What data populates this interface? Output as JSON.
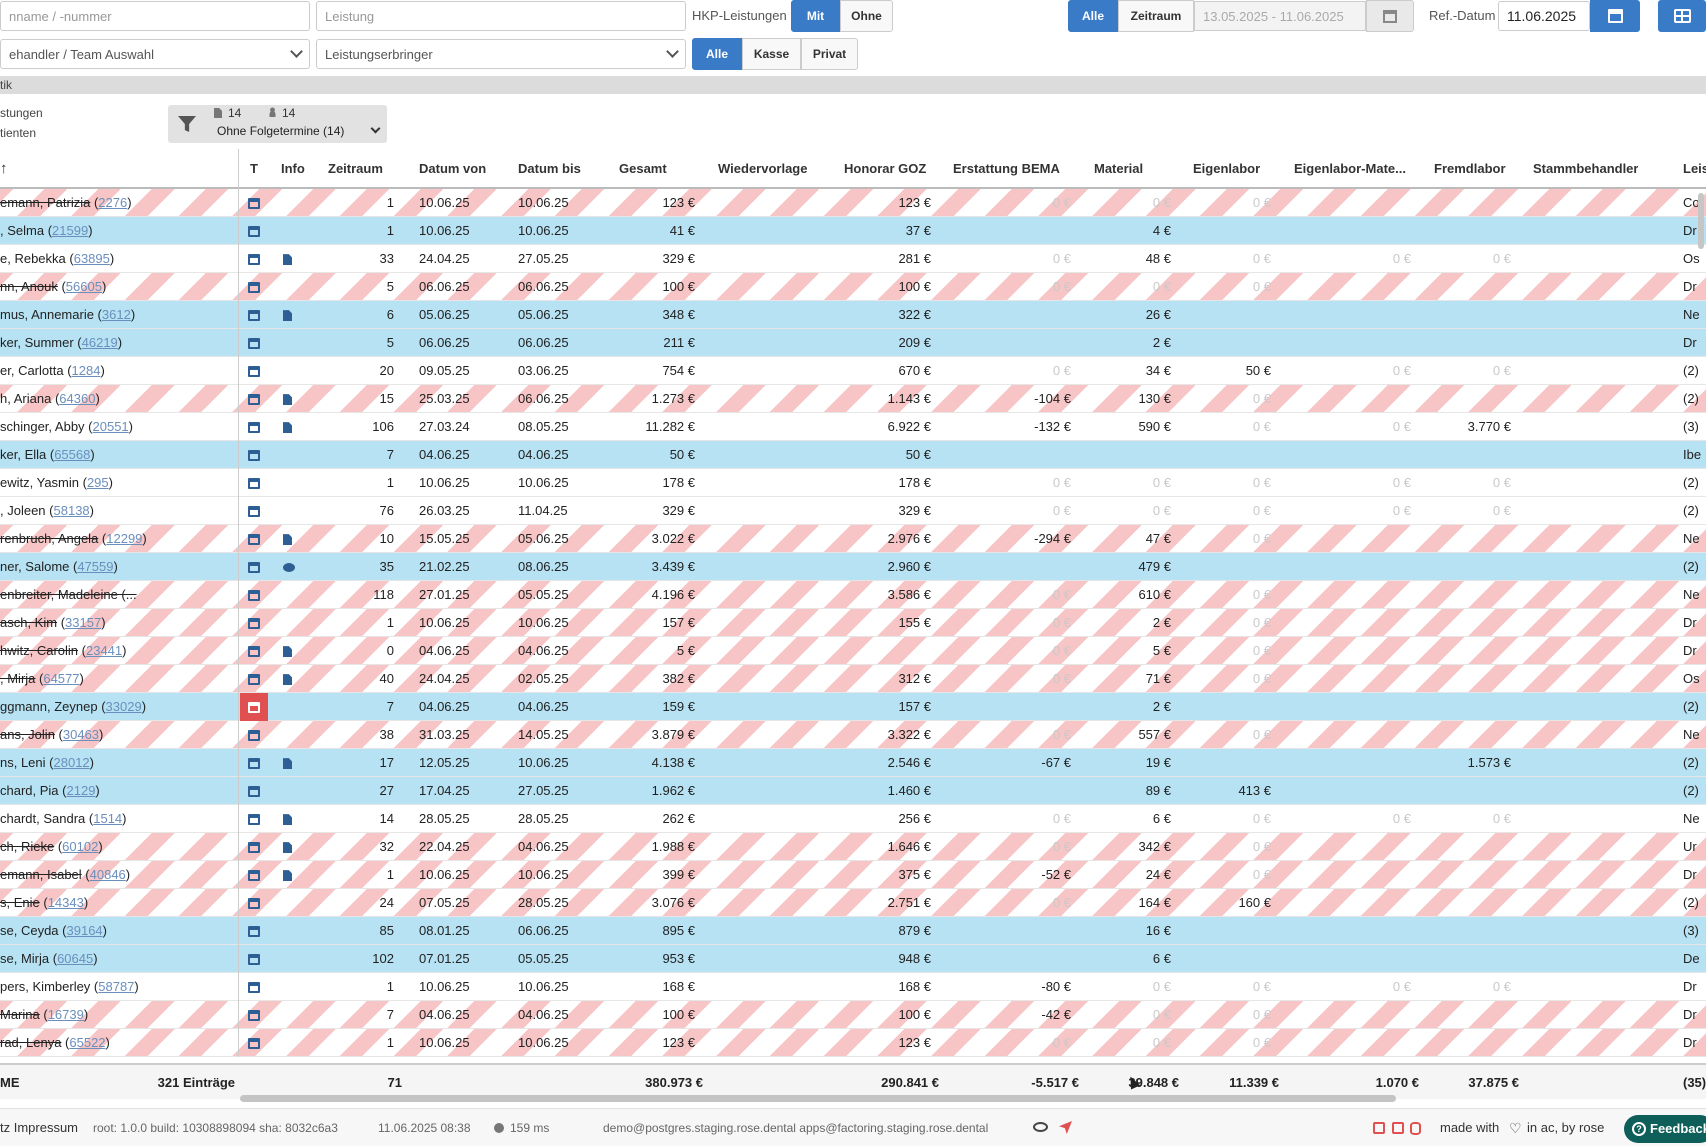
{
  "filters": {
    "patient_placeholder": "nname / -nummer",
    "leistung_placeholder": "Leistung",
    "hkp_label": "HKP-Leistungen",
    "hkp_mit": "Mit",
    "hkp_ohne": "Ohne",
    "period_alle": "Alle",
    "period_zeitraum": "Zeitraum",
    "date_range": "13.05.2025 - 11.06.2025",
    "ref_label": "Ref.-Datum",
    "ref_value": "11.06.2025",
    "behandler_placeholder": "ehandler / Team Auswahl",
    "erbringer_placeholder": "Leistungserbringer",
    "kasse_alle": "Alle",
    "kasse_kasse": "Kasse",
    "kasse_privat": "Privat"
  },
  "section_label": "tik",
  "stats": {
    "label_leistungen": "stungen",
    "label_patienten": "tienten",
    "count_docs": "14",
    "count_patients": "14",
    "filter_value": "Ohne Folgetermine (14)"
  },
  "columns": [
    "T",
    "Info",
    "Zeitraum",
    "Datum von",
    "Datum bis",
    "Gesamt",
    "Wiedervorlage",
    "Honorar GOZ",
    "Erstattung BEMA",
    "Material",
    "Eigenlabor",
    "Eigenlabor-Mate...",
    "Fremdlabor",
    "Stammbehandler",
    "Leis"
  ],
  "rows": [
    {
      "name": "emann, Patrizia",
      "id": "2276",
      "bg": "hatch",
      "strike": true,
      "icon": "",
      "cal": "n",
      "zeit": "1",
      "von": "10.06.25",
      "bis": "10.06.25",
      "gesamt": "123 €",
      "goz": "123 €",
      "bema": "0 €",
      "mat": "0 €",
      "eigen": "0 €",
      "eigmat": "",
      "fremd": "",
      "leis": "Co"
    },
    {
      "name": ", Selma",
      "id": "21599",
      "bg": "blue",
      "strike": false,
      "icon": "",
      "cal": "n",
      "zeit": "1",
      "von": "10.06.25",
      "bis": "10.06.25",
      "gesamt": "41 €",
      "goz": "37 €",
      "bema": "",
      "mat": "4 €",
      "eigen": "",
      "eigmat": "",
      "fremd": "",
      "leis": "Dr"
    },
    {
      "name": "e, Rebekka",
      "id": "63895",
      "bg": "plain",
      "strike": false,
      "icon": "doc",
      "cal": "n",
      "zeit": "33",
      "von": "24.04.25",
      "bis": "27.05.25",
      "gesamt": "329 €",
      "goz": "281 €",
      "bema": "0 €",
      "mat": "48 €",
      "eigen": "0 €",
      "eigmat": "0 €",
      "fremd": "0 €",
      "leis": "Os"
    },
    {
      "name": "nn, Anouk",
      "id": "56605",
      "bg": "hatch",
      "strike": true,
      "icon": "",
      "cal": "n",
      "zeit": "5",
      "von": "06.06.25",
      "bis": "06.06.25",
      "gesamt": "100 €",
      "goz": "100 €",
      "bema": "0 €",
      "mat": "0 €",
      "eigen": "0 €",
      "eigmat": "",
      "fremd": "",
      "leis": "Dr"
    },
    {
      "name": "mus, Annemarie",
      "id": "3612",
      "bg": "blue",
      "strike": false,
      "icon": "doc",
      "cal": "n",
      "zeit": "6",
      "von": "05.06.25",
      "bis": "05.06.25",
      "gesamt": "348 €",
      "goz": "322 €",
      "bema": "",
      "mat": "26 €",
      "eigen": "",
      "eigmat": "",
      "fremd": "",
      "leis": "Ne"
    },
    {
      "name": "ker, Summer",
      "id": "46219",
      "bg": "blue",
      "strike": false,
      "icon": "",
      "cal": "n",
      "zeit": "5",
      "von": "06.06.25",
      "bis": "06.06.25",
      "gesamt": "211 €",
      "goz": "209 €",
      "bema": "",
      "mat": "2 €",
      "eigen": "",
      "eigmat": "",
      "fremd": "",
      "leis": "Dr"
    },
    {
      "name": "er, Carlotta",
      "id": "1284",
      "bg": "plain",
      "strike": false,
      "icon": "",
      "cal": "n",
      "zeit": "20",
      "von": "09.05.25",
      "bis": "03.06.25",
      "gesamt": "754 €",
      "goz": "670 €",
      "bema": "0 €",
      "mat": "34 €",
      "eigen": "50 €",
      "eigmat": "0 €",
      "fremd": "0 €",
      "leis": "(2)"
    },
    {
      "name": "h, Ariana",
      "id": "64360",
      "bg": "hatch",
      "strike": false,
      "icon": "doc",
      "cal": "n",
      "zeit": "15",
      "von": "25.03.25",
      "bis": "06.06.25",
      "gesamt": "1.273 €",
      "goz": "1.143 €",
      "bema": "-104 €",
      "mat": "130 €",
      "eigen": "0 €",
      "eigmat": "",
      "fremd": "",
      "leis": "(2)"
    },
    {
      "name": "schinger, Abby",
      "id": "20551",
      "bg": "plain",
      "strike": false,
      "icon": "doc",
      "cal": "n",
      "zeit": "106",
      "von": "27.03.24",
      "bis": "08.05.25",
      "gesamt": "11.282 €",
      "goz": "6.922 €",
      "bema": "-132 €",
      "mat": "590 €",
      "eigen": "0 €",
      "eigmat": "0 €",
      "fremd": "3.770 €",
      "leis": "(3)"
    },
    {
      "name": "ker, Ella",
      "id": "65568",
      "bg": "blue",
      "strike": false,
      "icon": "",
      "cal": "n",
      "zeit": "7",
      "von": "04.06.25",
      "bis": "04.06.25",
      "gesamt": "50 €",
      "goz": "50 €",
      "bema": "",
      "mat": "",
      "eigen": "",
      "eigmat": "",
      "fremd": "",
      "leis": "Ibe"
    },
    {
      "name": "ewitz, Yasmin",
      "id": "295",
      "bg": "plain",
      "strike": false,
      "icon": "",
      "cal": "n",
      "zeit": "1",
      "von": "10.06.25",
      "bis": "10.06.25",
      "gesamt": "178 €",
      "goz": "178 €",
      "bema": "0 €",
      "mat": "0 €",
      "eigen": "0 €",
      "eigmat": "0 €",
      "fremd": "0 €",
      "leis": "(2)"
    },
    {
      "name": ", Joleen",
      "id": "58138",
      "bg": "plain",
      "strike": false,
      "icon": "",
      "cal": "n",
      "zeit": "76",
      "von": "26.03.25",
      "bis": "11.04.25",
      "gesamt": "329 €",
      "goz": "329 €",
      "bema": "0 €",
      "mat": "0 €",
      "eigen": "0 €",
      "eigmat": "0 €",
      "fremd": "0 €",
      "leis": "(2)"
    },
    {
      "name": "renbruch, Angela",
      "id": "12299",
      "bg": "hatch",
      "strike": true,
      "icon": "doc",
      "cal": "n",
      "zeit": "10",
      "von": "15.05.25",
      "bis": "05.06.25",
      "gesamt": "3.022 €",
      "goz": "2.976 €",
      "bema": "-294 €",
      "mat": "47 €",
      "eigen": "0 €",
      "eigmat": "",
      "fremd": "",
      "leis": "Ne"
    },
    {
      "name": "ner, Salome",
      "id": "47559",
      "bg": "blue",
      "strike": false,
      "icon": "bub",
      "cal": "n",
      "zeit": "35",
      "von": "21.02.25",
      "bis": "08.06.25",
      "gesamt": "3.439 €",
      "goz": "2.960 €",
      "bema": "",
      "mat": "479 €",
      "eigen": "",
      "eigmat": "",
      "fremd": "",
      "leis": "(2)"
    },
    {
      "name": "enbreiter, Madeleine (...",
      "id": "",
      "bg": "hatch",
      "strike": true,
      "icon": "",
      "cal": "n",
      "zeit": "118",
      "von": "27.01.25",
      "bis": "05.05.25",
      "gesamt": "4.196 €",
      "goz": "3.586 €",
      "bema": "0 €",
      "mat": "610 €",
      "eigen": "0 €",
      "eigmat": "",
      "fremd": "",
      "leis": "Ne"
    },
    {
      "name": "asch, Kim",
      "id": "33157",
      "bg": "hatch",
      "strike": true,
      "icon": "",
      "cal": "n",
      "zeit": "1",
      "von": "10.06.25",
      "bis": "10.06.25",
      "gesamt": "157 €",
      "goz": "155 €",
      "bema": "0 €",
      "mat": "2 €",
      "eigen": "0 €",
      "eigmat": "",
      "fremd": "",
      "leis": "Dr"
    },
    {
      "name": "hwitz, Carolin",
      "id": "23441",
      "bg": "hatch",
      "strike": true,
      "icon": "doc",
      "cal": "n",
      "zeit": "0",
      "von": "04.06.25",
      "bis": "04.06.25",
      "gesamt": "5 €",
      "goz": "",
      "bema": "0 €",
      "mat": "5 €",
      "eigen": "0 €",
      "eigmat": "",
      "fremd": "",
      "leis": "Dr"
    },
    {
      "name": ", Mirja",
      "id": "64577",
      "bg": "hatch",
      "strike": true,
      "icon": "doc",
      "cal": "n",
      "zeit": "40",
      "von": "24.04.25",
      "bis": "02.05.25",
      "gesamt": "382 €",
      "goz": "312 €",
      "bema": "0 €",
      "mat": "71 €",
      "eigen": "0 €",
      "eigmat": "",
      "fremd": "",
      "leis": "Os"
    },
    {
      "name": "ggmann, Zeynep",
      "id": "33029",
      "bg": "blue",
      "strike": false,
      "icon": "",
      "cal": "r",
      "zeit": "7",
      "von": "04.06.25",
      "bis": "04.06.25",
      "gesamt": "159 €",
      "goz": "157 €",
      "bema": "",
      "mat": "2 €",
      "eigen": "",
      "eigmat": "",
      "fremd": "",
      "leis": "(2)"
    },
    {
      "name": "ans, Jolin",
      "id": "30463",
      "bg": "hatch",
      "strike": true,
      "icon": "",
      "cal": "n",
      "zeit": "38",
      "von": "31.03.25",
      "bis": "14.05.25",
      "gesamt": "3.879 €",
      "goz": "3.322 €",
      "bema": "0 €",
      "mat": "557 €",
      "eigen": "0 €",
      "eigmat": "",
      "fremd": "",
      "leis": "Ne"
    },
    {
      "name": "ns, Leni",
      "id": "28012",
      "bg": "blue",
      "strike": false,
      "icon": "doc",
      "cal": "n",
      "zeit": "17",
      "von": "12.05.25",
      "bis": "10.06.25",
      "gesamt": "4.138 €",
      "goz": "2.546 €",
      "bema": "-67 €",
      "mat": "19 €",
      "eigen": "",
      "eigmat": "",
      "fremd": "1.573 €",
      "leis": "(2)"
    },
    {
      "name": "chard, Pia",
      "id": "2129",
      "bg": "blue",
      "strike": false,
      "icon": "",
      "cal": "n",
      "zeit": "27",
      "von": "17.04.25",
      "bis": "27.05.25",
      "gesamt": "1.962 €",
      "goz": "1.460 €",
      "bema": "",
      "mat": "89 €",
      "eigen": "413 €",
      "eigmat": "",
      "fremd": "",
      "leis": "(2)"
    },
    {
      "name": "chardt, Sandra",
      "id": "1514",
      "bg": "plain",
      "strike": false,
      "icon": "doc",
      "cal": "n",
      "zeit": "14",
      "von": "28.05.25",
      "bis": "28.05.25",
      "gesamt": "262 €",
      "goz": "256 €",
      "bema": "0 €",
      "mat": "6 €",
      "eigen": "0 €",
      "eigmat": "0 €",
      "fremd": "0 €",
      "leis": "Ne"
    },
    {
      "name": "ch, Rieke",
      "id": "60102",
      "bg": "hatch",
      "strike": true,
      "icon": "doc",
      "cal": "n",
      "zeit": "32",
      "von": "22.04.25",
      "bis": "04.06.25",
      "gesamt": "1.988 €",
      "goz": "1.646 €",
      "bema": "0 €",
      "mat": "342 €",
      "eigen": "0 €",
      "eigmat": "",
      "fremd": "",
      "leis": "Ur"
    },
    {
      "name": "emann, Isabel",
      "id": "40846",
      "bg": "hatch",
      "strike": true,
      "icon": "doc",
      "cal": "n",
      "zeit": "1",
      "von": "10.06.25",
      "bis": "10.06.25",
      "gesamt": "399 €",
      "goz": "375 €",
      "bema": "-52 €",
      "mat": "24 €",
      "eigen": "0 €",
      "eigmat": "",
      "fremd": "",
      "leis": "Dr"
    },
    {
      "name": "s, Enie",
      "id": "14343",
      "bg": "hatch",
      "strike": true,
      "icon": "",
      "cal": "n",
      "zeit": "24",
      "von": "07.05.25",
      "bis": "28.05.25",
      "gesamt": "3.076 €",
      "goz": "2.751 €",
      "bema": "0 €",
      "mat": "164 €",
      "eigen": "160 €",
      "eigmat": "",
      "fremd": "",
      "leis": "(2)"
    },
    {
      "name": "se, Ceyda",
      "id": "39164",
      "bg": "blue",
      "strike": false,
      "icon": "",
      "cal": "n",
      "zeit": "85",
      "von": "08.01.25",
      "bis": "06.06.25",
      "gesamt": "895 €",
      "goz": "879 €",
      "bema": "",
      "mat": "16 €",
      "eigen": "",
      "eigmat": "",
      "fremd": "",
      "leis": "(3)"
    },
    {
      "name": "se, Mirja",
      "id": "60645",
      "bg": "blue",
      "strike": false,
      "icon": "",
      "cal": "n",
      "zeit": "102",
      "von": "07.01.25",
      "bis": "05.05.25",
      "gesamt": "953 €",
      "goz": "948 €",
      "bema": "",
      "mat": "6 €",
      "eigen": "",
      "eigmat": "",
      "fremd": "",
      "leis": "De"
    },
    {
      "name": "pers, Kimberley",
      "id": "58787",
      "bg": "plain",
      "strike": false,
      "icon": "",
      "cal": "n",
      "zeit": "1",
      "von": "10.06.25",
      "bis": "10.06.25",
      "gesamt": "168 €",
      "goz": "168 €",
      "bema": "-80 €",
      "mat": "0 €",
      "eigen": "0 €",
      "eigmat": "0 €",
      "fremd": "0 €",
      "leis": "Dr"
    },
    {
      "name": "Marina",
      "id": "16739",
      "bg": "hatch",
      "strike": true,
      "icon": "",
      "cal": "n",
      "zeit": "7",
      "von": "04.06.25",
      "bis": "04.06.25",
      "gesamt": "100 €",
      "goz": "100 €",
      "bema": "-42 €",
      "mat": "0 €",
      "eigen": "0 €",
      "eigmat": "",
      "fremd": "",
      "leis": "Dr"
    },
    {
      "name": "rad, Lenya",
      "id": "65522",
      "bg": "hatch",
      "strike": true,
      "icon": "",
      "cal": "n",
      "zeit": "1",
      "von": "10.06.25",
      "bis": "10.06.25",
      "gesamt": "123 €",
      "goz": "123 €",
      "bema": "0 €",
      "mat": "0 €",
      "eigen": "0 €",
      "eigmat": "",
      "fremd": "",
      "leis": "Dr"
    }
  ],
  "summary": {
    "label": "ME",
    "entries": "321 Einträge",
    "zeit": "71",
    "gesamt": "380.973 €",
    "goz": "290.841 €",
    "bema": "-5.517 €",
    "mat": "39.848 €",
    "eigen": "11.339 €",
    "eigmat": "1.070 €",
    "fremd": "37.875 €",
    "leis": "(35)"
  },
  "footer": {
    "impressum": "tz  Impressum",
    "version": "root: 1.0.0  build: 10308898094  sha: 8032c6a3",
    "timestamp": "11.06.2025 08:38",
    "timing": "159 ms",
    "db": "demo@postgres.staging.rose.dental  apps@factoring.staging.rose.dental",
    "made_with": "made with",
    "made_by": "in ac, by rose",
    "feedback": "Feedback"
  },
  "colors": {
    "accent": "#3a7bc8",
    "row_blue": "#b6e2f3",
    "row_hatch": "#f7c5c5",
    "alert_red": "#e05050"
  }
}
